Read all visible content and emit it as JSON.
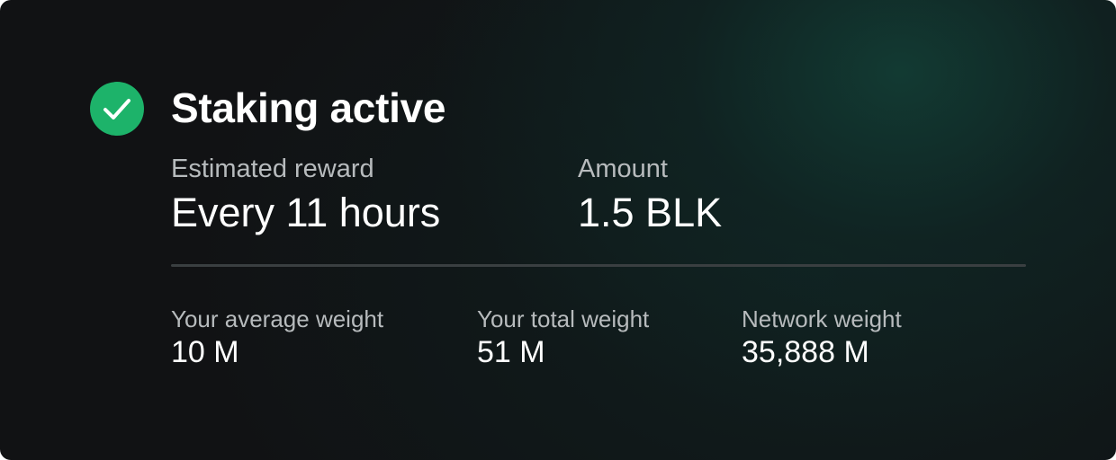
{
  "status": {
    "title": "Staking active",
    "icon": "check-circle-icon",
    "icon_color": "#1db36a"
  },
  "summary": {
    "reward": {
      "label": "Estimated reward",
      "value": "Every 11 hours"
    },
    "amount": {
      "label": "Amount",
      "value": "1.5 BLK"
    }
  },
  "weights": [
    {
      "label": "Your average weight",
      "value": "10 M"
    },
    {
      "label": "Your total weight",
      "value": "51 M"
    },
    {
      "label": "Network weight",
      "value": "35,888 M"
    }
  ],
  "colors": {
    "background": "#111214",
    "accent_glow": "#123c34",
    "label_text": "#b7bbbd",
    "divider": "#3a3f41"
  }
}
